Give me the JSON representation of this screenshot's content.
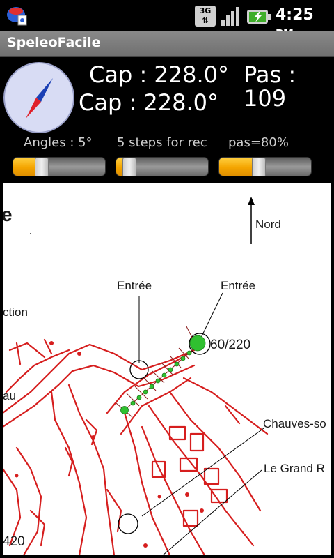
{
  "status_bar": {
    "network_type": "3G",
    "time": "4:25",
    "ampm": "PM",
    "icons": [
      "app-notification-icon",
      "network-3g-icon",
      "signal-strength-icon",
      "battery-charging-icon"
    ]
  },
  "app": {
    "title": "SpeleoFacile"
  },
  "readouts": {
    "cap_line1": "Cap :  228.0°",
    "cap_line2": "Cap : 228.0°",
    "pas_label": "Pas :",
    "pas_value": "109"
  },
  "sliders": [
    {
      "label": "Angles : 5°",
      "level": 0.28
    },
    {
      "label": "5 steps for rec",
      "level": 0.08
    },
    {
      "label": "pas=80%",
      "level": 0.42
    }
  ],
  "map": {
    "labels": {
      "title_fragment": "e",
      "nord": "Nord",
      "entree_left": "Entrée",
      "entree_right": "Entrée",
      "ction": "ction",
      "au": "au",
      "bearing": "60/220",
      "chauves": "Chauves-so",
      "grand": "Le Grand R",
      "num420": "420"
    }
  },
  "colors": {
    "accent_orange": "#f4a400",
    "compass_face": "#d8dcf4",
    "needle_red": "#e0202a",
    "cave_red": "#d61e1e",
    "track_green": "#30c030"
  }
}
